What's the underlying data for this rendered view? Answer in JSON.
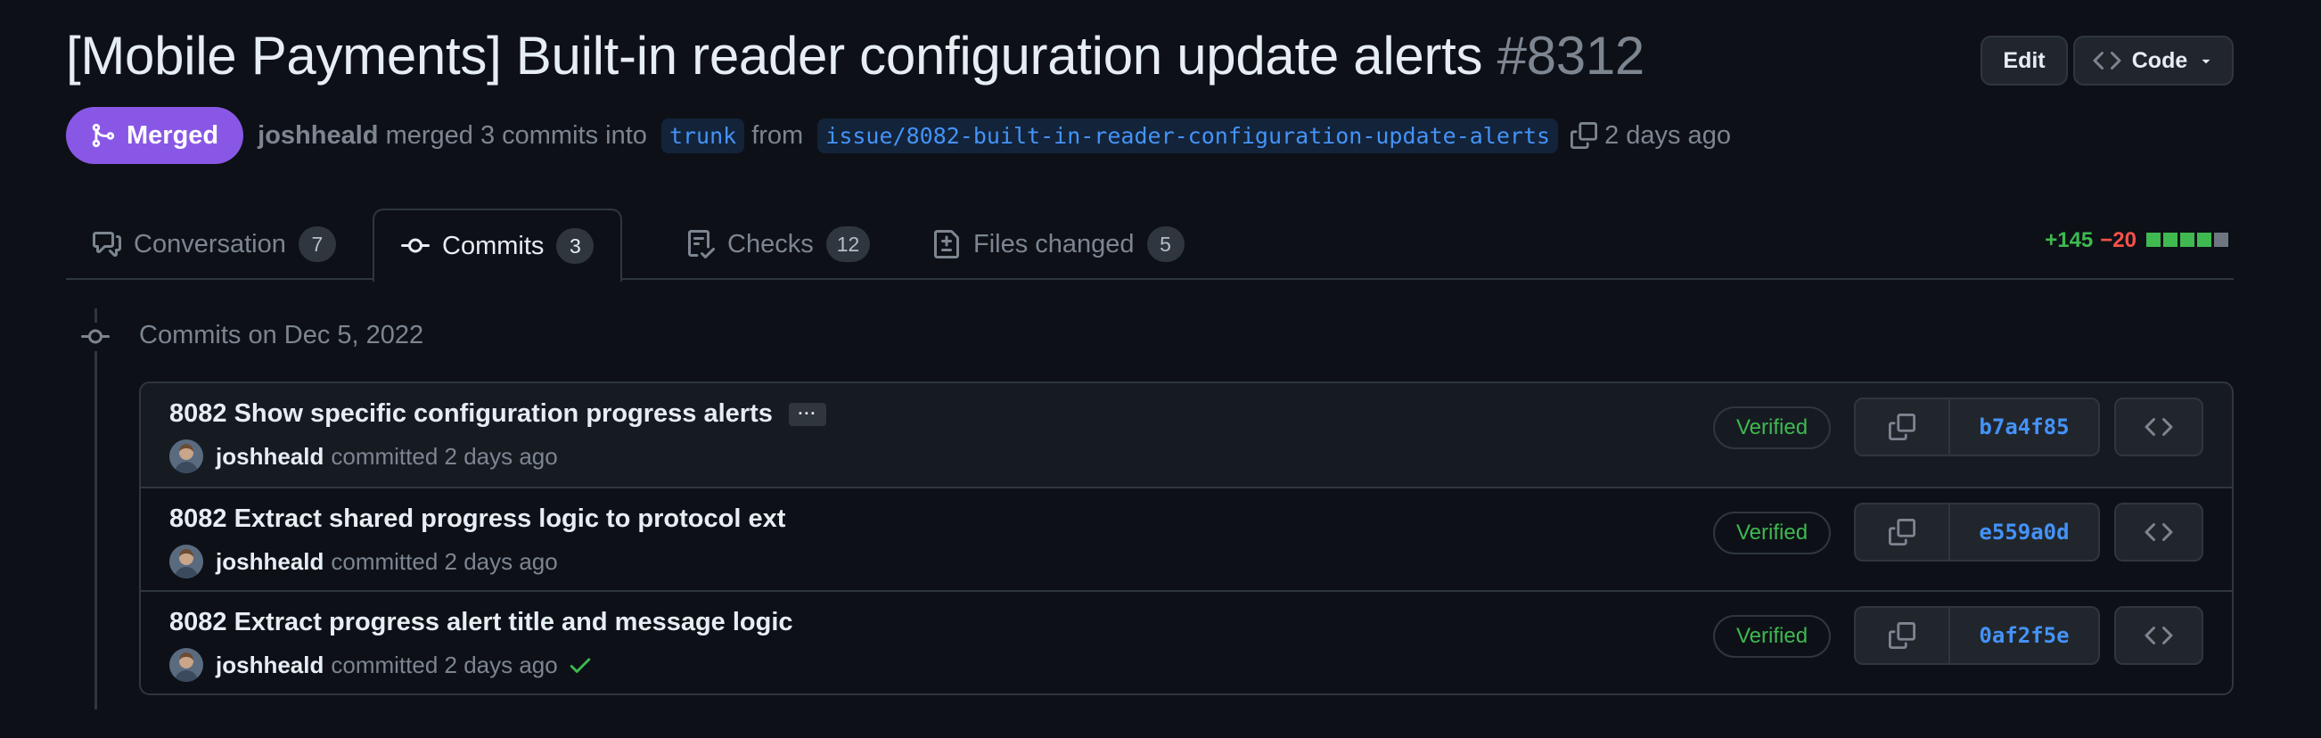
{
  "pr": {
    "title": "[Mobile Payments] Built-in reader configuration update alerts",
    "number": "#8312",
    "edit_label": "Edit",
    "code_label": "Code",
    "state_label": "Merged",
    "author": "joshheald",
    "merge_text": "merged 3 commits into",
    "base_branch": "trunk",
    "from_text": "from",
    "head_branch": "issue/8082-built-in-reader-configuration-update-alerts",
    "time": "2 days ago"
  },
  "tabs": [
    {
      "label": "Conversation",
      "count": "7",
      "icon": "comment-discussion-icon"
    },
    {
      "label": "Commits",
      "count": "3",
      "icon": "git-commit-icon"
    },
    {
      "label": "Checks",
      "count": "12",
      "icon": "checklist-icon"
    },
    {
      "label": "Files changed",
      "count": "5",
      "icon": "file-diff-icon"
    }
  ],
  "diffstat": {
    "additions": "+145",
    "deletions": "−20",
    "blocks": [
      "#3fb950",
      "#3fb950",
      "#3fb950",
      "#3fb950",
      "#6e7681"
    ]
  },
  "commits_heading": "Commits on Dec 5, 2022",
  "commits": [
    {
      "message": "8082 Show specific configuration progress alerts",
      "author": "joshheald",
      "action": "committed",
      "time": "2 days ago",
      "verified": "Verified",
      "sha": "b7a4f85",
      "ellipsis": "···"
    },
    {
      "message": "8082 Extract shared progress logic to protocol ext",
      "author": "joshheald",
      "action": "committed",
      "time": "2 days ago",
      "verified": "Verified",
      "sha": "e559a0d"
    },
    {
      "message": "8082 Extract progress alert title and message logic",
      "author": "joshheald",
      "action": "committed",
      "time": "2 days ago",
      "verified": "Verified",
      "sha": "0af2f5e",
      "status_icon": "check-icon"
    }
  ],
  "colors": {
    "merged": "#8957e5",
    "link": "#4493f8",
    "success": "#3fb950",
    "danger": "#f85149",
    "background": "#0d1117"
  }
}
